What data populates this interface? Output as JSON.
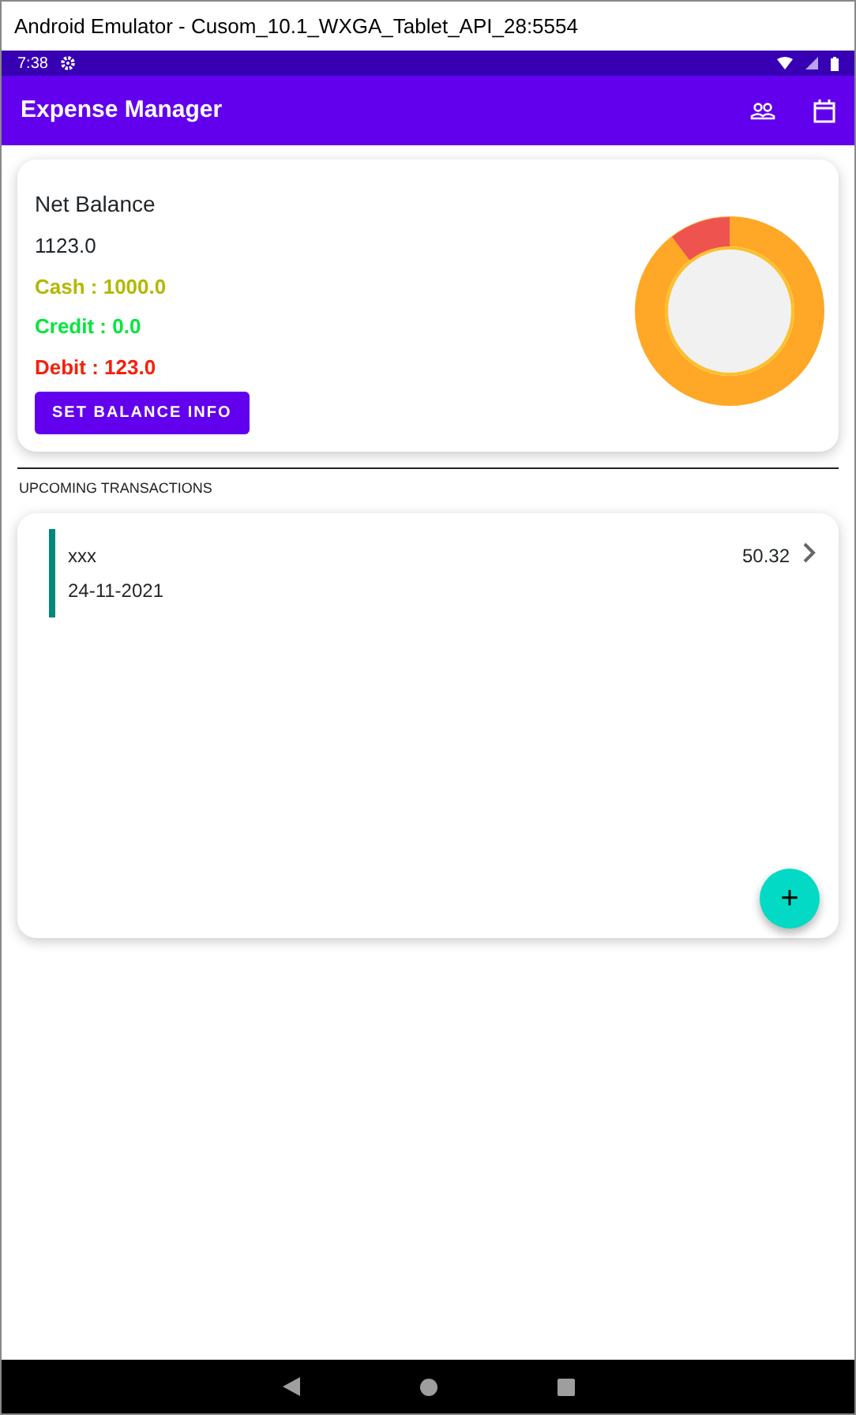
{
  "window": {
    "title": "Android Emulator - Cusom_10.1_WXGA_Tablet_API_28:5554"
  },
  "status_bar": {
    "time": "7:38"
  },
  "app_bar": {
    "title": "Expense Manager"
  },
  "balance_card": {
    "title": "Net Balance",
    "total": "1123.0",
    "lines": [
      {
        "text": "Cash : 1000.0",
        "color": "#b3b800"
      },
      {
        "text": "Credit : 0.0",
        "color": "#00e63c"
      },
      {
        "text": "Debit : 123.0",
        "color": "#f5200c"
      }
    ],
    "button": "SET BALANCE INFO"
  },
  "upcoming": {
    "heading": "UPCOMING TRANSACTIONS",
    "transactions": [
      {
        "name": "xxx",
        "date": "24-11-2021",
        "amount": "50.32"
      }
    ],
    "fab": "+"
  }
}
